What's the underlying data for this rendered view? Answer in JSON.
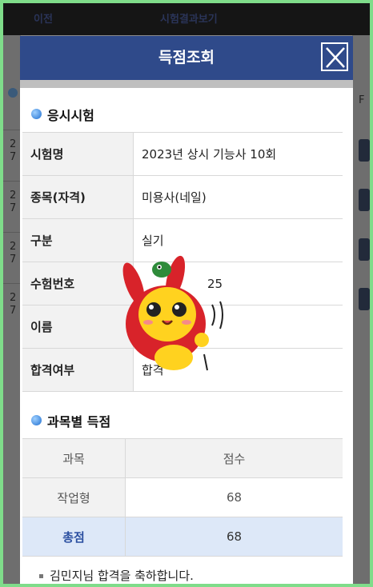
{
  "topbar": {
    "back_label": "이전",
    "title": "시험결과보기"
  },
  "background_rows": [
    "2\n7",
    "2\n7",
    "2\n7",
    "2\n7"
  ],
  "background_header_fragment": "F",
  "modal": {
    "title": "득점조회",
    "close_icon": "close-x-icon",
    "exam_section_title": "응시시험",
    "exam_info": [
      {
        "label": "시험명",
        "value": "2023년 상시 기능사 10회"
      },
      {
        "label": "종목(자격)",
        "value": "미용사(네일)"
      },
      {
        "label": "구분",
        "value": "실기"
      },
      {
        "label": "수험번호",
        "value": "25"
      },
      {
        "label": "이름",
        "value": ""
      },
      {
        "label": "합격여부",
        "value": "합격"
      }
    ],
    "score_section_title": "과목별 득점",
    "score_table": {
      "headers": [
        "과목",
        "점수"
      ],
      "rows": [
        {
          "subject": "작업형",
          "score": "68"
        }
      ],
      "total": {
        "label": "총점",
        "score": "68"
      }
    },
    "congrats_message": "김민지님 합격을 축하합니다."
  },
  "colors": {
    "header": "#2f4a8a",
    "accent_total_row": "#dde8f8",
    "page_border": "#7fdc8a"
  },
  "sticker_icon": "cartoon-character-sticker-icon"
}
